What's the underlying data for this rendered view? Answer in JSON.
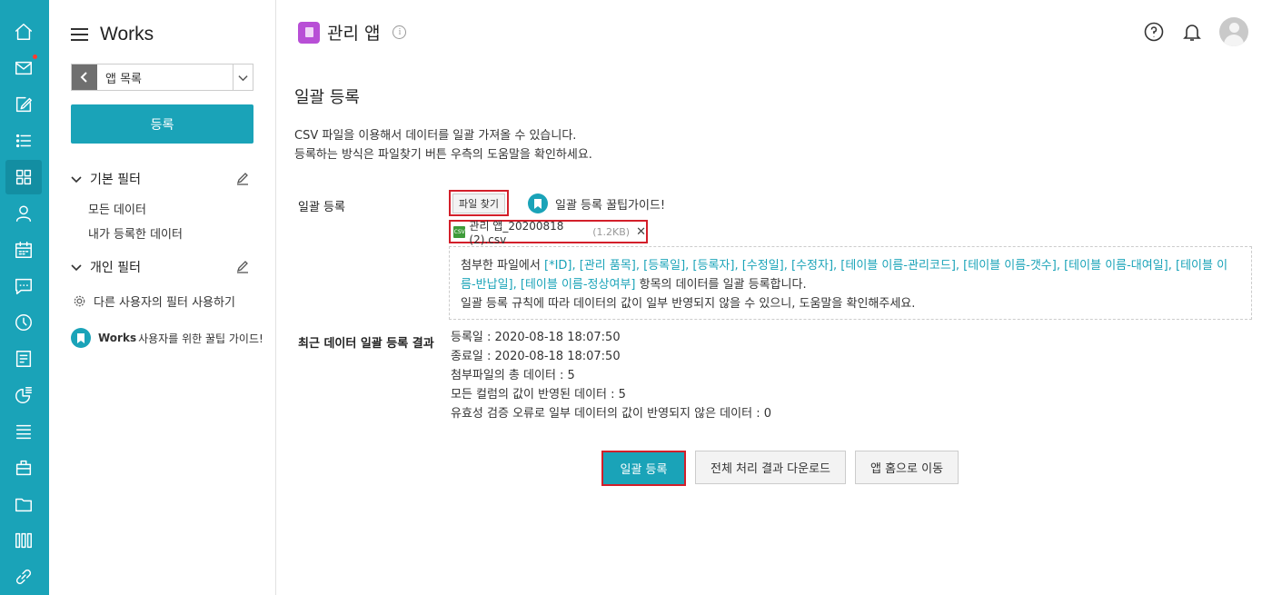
{
  "app": {
    "brand": "Works"
  },
  "rail": {
    "items": [
      {
        "icon": "home-icon"
      },
      {
        "icon": "mail-icon",
        "badge": true
      },
      {
        "icon": "edit-icon"
      },
      {
        "icon": "list-icon"
      },
      {
        "icon": "apps-grid-icon",
        "active": true
      },
      {
        "icon": "person-icon"
      },
      {
        "icon": "calendar-icon"
      },
      {
        "icon": "chat-icon"
      },
      {
        "icon": "clock-icon"
      },
      {
        "icon": "board-icon"
      },
      {
        "icon": "report-icon"
      },
      {
        "icon": "stack-icon"
      },
      {
        "icon": "briefcase-icon"
      },
      {
        "icon": "folder-icon"
      },
      {
        "icon": "library-icon"
      },
      {
        "icon": "link-icon"
      }
    ]
  },
  "sidebar": {
    "app_select_label": "앱 목록",
    "register_button": "등록",
    "basic_filter": {
      "title": "기본 필터",
      "items": [
        "모든 데이터",
        "내가 등록한 데이터"
      ]
    },
    "personal_filter": {
      "title": "개인 필터"
    },
    "other_filter_label": "다른 사용자의 필터 사용하기",
    "tip_guide": {
      "bold": "Works",
      "text": "사용자를 위한 꿀팁 가이드!"
    }
  },
  "header": {
    "app_name": "관리 앱",
    "info_glyph": "i"
  },
  "main": {
    "section_title": "일괄 등록",
    "desc_lines": [
      "CSV 파일을 이용해서 데이터를 일괄 가져올 수 있습니다.",
      "등록하는 방식은 파일찾기 버튼 우측의 도움말을 확인하세요."
    ],
    "bulk": {
      "label": "일괄 등록",
      "file_button": "파일 찾기",
      "guide_link": "일괄 등록 꿀팁가이드!",
      "file_name": "관리 앱_20200818 (2).csv",
      "file_size": "(1.2KB)",
      "file_icon_text": "CSV",
      "remove_glyph": "✕"
    },
    "notice": {
      "prefix": "첨부한 파일에서 ",
      "columns": "[*ID], [관리 품목], [등록일], [등록자], [수정일], [수정자], [테이블 이름-관리코드], [테이블 이름-갯수], [테이블 이름-대여일], [테이블 이름-반납일], [테이블 이름-정상여부]",
      "suffix": " 항목의 데이터를 일괄 등록합니다.",
      "line2": "일괄 등록 규칙에 따라 데이터의 값이 일부 반영되지 않을 수 있으니, 도움말을 확인해주세요."
    },
    "result": {
      "label": "최근 데이터 일괄 등록 결과",
      "lines": [
        "등록일 : 2020-08-18 18:07:50",
        "종료일 : 2020-08-18 18:07:50",
        "첨부파일의 총 데이터 : 5",
        "모든 컬럼의 값이 반영된 데이터 : 5",
        "유효성 검증 오류로 일부 데이터의 값이 반영되지 않은 데이터 : 0"
      ]
    },
    "actions": {
      "primary": "일괄 등록",
      "download": "전체 처리 결과 다운로드",
      "home": "앱 홈으로 이동"
    }
  },
  "colors": {
    "accent": "#1aa3b8",
    "highlight": "#d31f2a",
    "app_icon": "#b84fd6"
  }
}
